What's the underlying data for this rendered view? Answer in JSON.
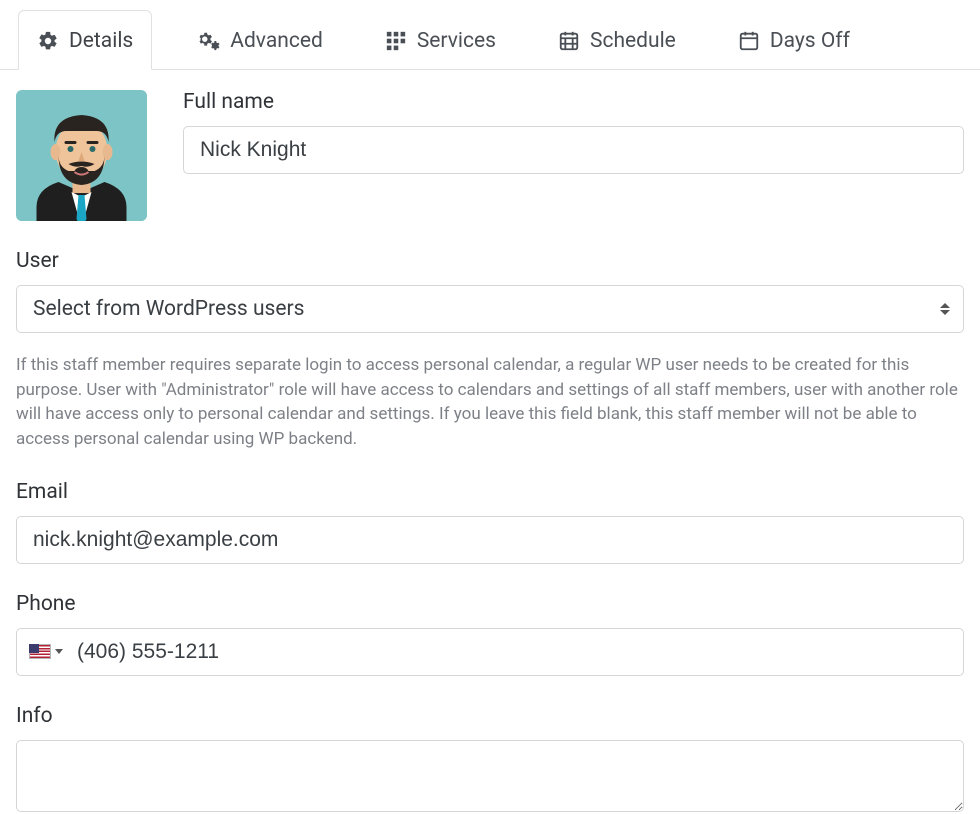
{
  "tabs": {
    "details": "Details",
    "advanced": "Advanced",
    "services": "Services",
    "schedule": "Schedule",
    "days_off": "Days Off"
  },
  "form": {
    "full_name_label": "Full name",
    "full_name_value": "Nick Knight",
    "user_label": "User",
    "user_select_value": "Select from WordPress users",
    "user_help": "If this staff member requires separate login to access personal calendar, a regular WP user needs to be created for this purpose. User with \"Administrator\" role will have access to calendars and settings of all staff members, user with another role will have access only to personal calendar and settings. If you leave this field blank, this staff member will not be able to access personal calendar using WP backend.",
    "email_label": "Email",
    "email_value": "nick.knight@example.com",
    "phone_label": "Phone",
    "phone_value": "(406) 555-1211",
    "phone_country": "US",
    "info_label": "Info",
    "info_value": ""
  }
}
